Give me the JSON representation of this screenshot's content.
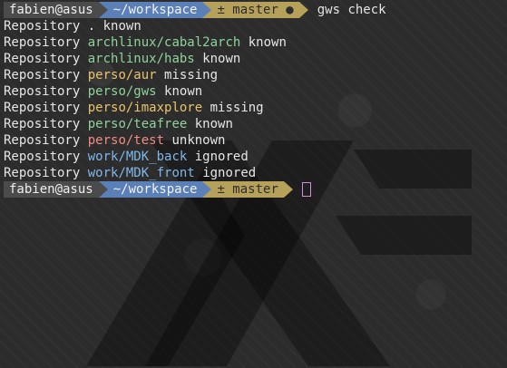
{
  "prompt": {
    "user": "fabien@asus",
    "path": "~/workspace",
    "git": "± master ●",
    "git_no_dot": "± master"
  },
  "command": "gws check",
  "lines": [
    {
      "prefix": "Repository",
      "repo": ".",
      "status": "known",
      "repo_class": "plain"
    },
    {
      "prefix": "Repository",
      "repo": "archlinux/cabal2arch",
      "status": "known",
      "repo_class": "known"
    },
    {
      "prefix": "Repository",
      "repo": "archlinux/habs",
      "status": "known",
      "repo_class": "known"
    },
    {
      "prefix": "Repository",
      "repo": "perso/aur",
      "status": "missing",
      "repo_class": "missing"
    },
    {
      "prefix": "Repository",
      "repo": "perso/gws",
      "status": "known",
      "repo_class": "known"
    },
    {
      "prefix": "Repository",
      "repo": "perso/imaxplore",
      "status": "missing",
      "repo_class": "missing"
    },
    {
      "prefix": "Repository",
      "repo": "perso/teafree",
      "status": "known",
      "repo_class": "known"
    },
    {
      "prefix": "Repository",
      "repo": "perso/test",
      "status": "unknown",
      "repo_class": "unknown"
    },
    {
      "prefix": "Repository",
      "repo": "work/MDK_back",
      "status": "ignored",
      "repo_class": "ignored"
    },
    {
      "prefix": "Repository",
      "repo": "work/MDK_front",
      "status": "ignored",
      "repo_class": "ignored"
    }
  ],
  "colors": {
    "user_bg": "#4b4b4b",
    "path_bg": "#5b80b8",
    "git_bg": "#b6a15b",
    "known": "#8fd39a",
    "missing": "#e9c46a",
    "unknown": "#f28b82",
    "ignored": "#7fb7e8",
    "cursor": "#d98bd7"
  }
}
